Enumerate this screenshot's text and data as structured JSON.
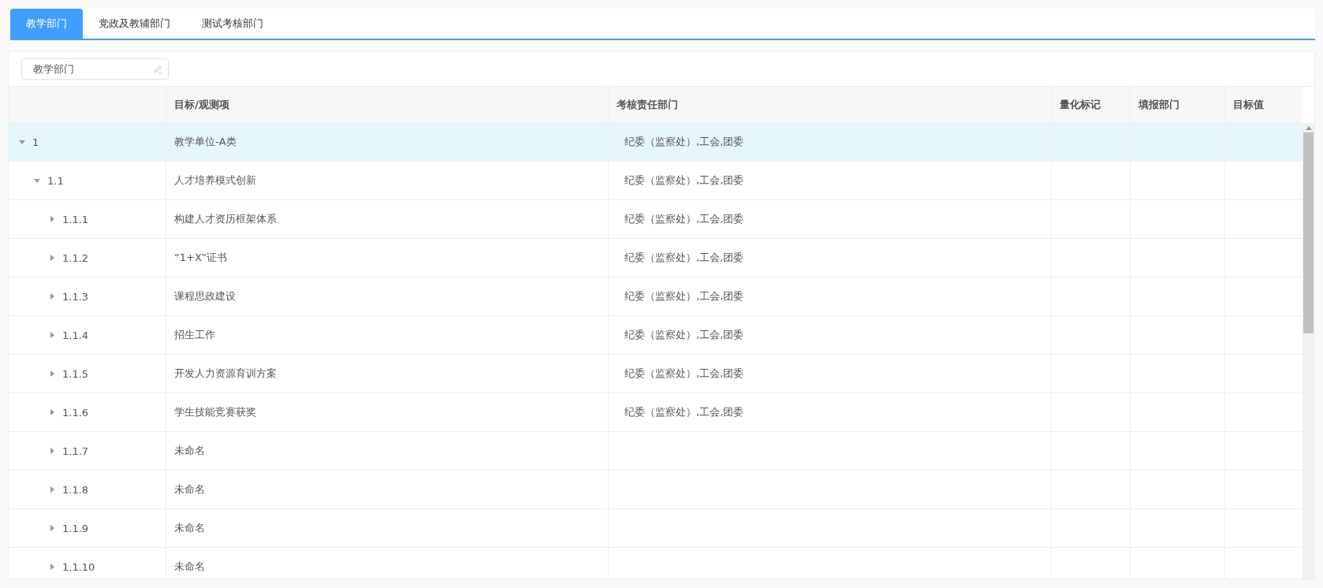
{
  "tabs": [
    {
      "label": "教学部门",
      "selected": true
    },
    {
      "label": "党政及教辅部门",
      "selected": false
    },
    {
      "label": "测试考核部门",
      "selected": false
    }
  ],
  "department_field": {
    "value": "教学部门"
  },
  "table": {
    "columns": [
      "",
      "目标/观测项",
      "考核责任部门",
      "量化标记",
      "填报部门",
      "目标值"
    ],
    "rows": [
      {
        "code": "1",
        "item": "教学单位-A类",
        "department": "纪委（监察处）,工会,团委",
        "selected": true,
        "expanded": true,
        "children": [
          {
            "code": "1.1",
            "item": "人才培养模式创新",
            "department": "纪委（监察处）,工会,团委",
            "selected": false,
            "expanded": true,
            "children": [
              {
                "code": "1.1.1",
                "item": "构建人才资历框架体系",
                "department": "纪委（监察处）,工会,团委",
                "selected": false,
                "expanded": false
              },
              {
                "code": "1.1.2",
                "item": "“1+X”证书",
                "department": "纪委（监察处）,工会,团委",
                "selected": false,
                "expanded": false
              },
              {
                "code": "1.1.3",
                "item": "课程思政建设",
                "department": "纪委（监察处）,工会,团委",
                "selected": false,
                "expanded": false
              },
              {
                "code": "1.1.4",
                "item": "招生工作",
                "department": "纪委（监察处）,工会,团委",
                "selected": false,
                "expanded": false
              },
              {
                "code": "1.1.5",
                "item": "开发人力资源育训方案",
                "department": "纪委（监察处）,工会,团委",
                "selected": false,
                "expanded": false
              },
              {
                "code": "1.1.6",
                "item": "学生技能竞赛获奖",
                "department": "纪委（监察处）,工会,团委",
                "selected": false,
                "expanded": false
              },
              {
                "code": "1.1.7",
                "item": "未命名",
                "selected": false,
                "expanded": false
              },
              {
                "code": "1.1.8",
                "item": "未命名",
                "selected": false,
                "expanded": false
              },
              {
                "code": "1.1.9",
                "item": "未命名",
                "selected": false,
                "expanded": false
              },
              {
                "code": "1.1.10",
                "item": "未命名",
                "selected": false,
                "expanded": false
              }
            ]
          }
        ]
      }
    ]
  }
}
